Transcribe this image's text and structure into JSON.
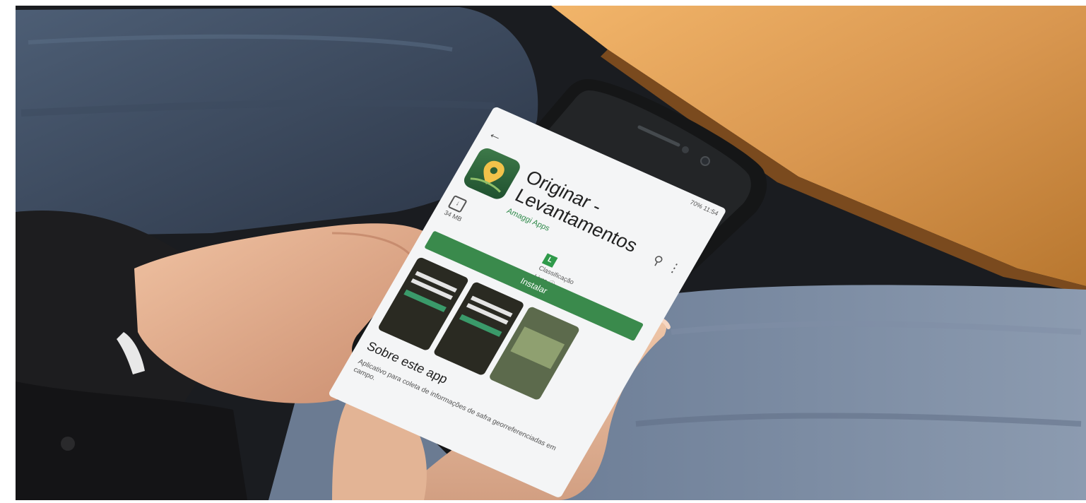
{
  "status_bar": {
    "signal_text": "70%",
    "clock": "11:54"
  },
  "app": {
    "title": "Originar - Levantamentos",
    "developer": "Amaggi Apps",
    "size_label": "34 MB",
    "rating_badge": "L",
    "rating_label": "Classificação",
    "rating_sub": "Livre ⓘ",
    "install_label": "Instalar"
  },
  "about": {
    "title": "Sobre este app",
    "description": "Aplicativo para coleta de informações de safra georreferenciadas em campo."
  },
  "colors": {
    "install_green": "#3a8a4c",
    "table_wood": "#d89a55",
    "jeans": "#6f7e92",
    "jacket": "#1e1e1e"
  }
}
